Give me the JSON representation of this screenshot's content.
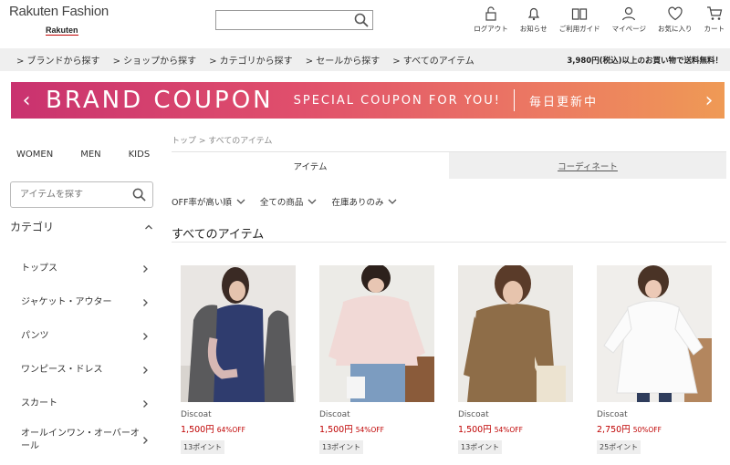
{
  "header": {
    "logo_main": "Rakuten Fashion",
    "logo_sub": "Rakuten",
    "search_placeholder": "",
    "nav": [
      {
        "icon": "lock-icon",
        "label": "ログアウト"
      },
      {
        "icon": "bell-icon",
        "label": "お知らせ"
      },
      {
        "icon": "book-icon",
        "label": "ご利用ガイド"
      },
      {
        "icon": "user-icon",
        "label": "マイページ"
      },
      {
        "icon": "heart-icon",
        "label": "お気に入り"
      },
      {
        "icon": "cart-icon",
        "label": "カート"
      }
    ]
  },
  "subnav": {
    "links": [
      "> ブランドから探す",
      "> ショップから探す",
      "> カテゴリから探す",
      "> セールから探す",
      "> すべてのアイテム"
    ],
    "shipping_note": "3,980円(税込)以上のお買い物で送料無料！"
  },
  "banner": {
    "title": "BRAND COUPON",
    "subtitle": "SPECIAL COUPON FOR YOU!",
    "daily": "毎日更新中",
    "prev": "‹",
    "next": "›"
  },
  "sidebar": {
    "genders": [
      "WOMEN",
      "MEN",
      "KIDS"
    ],
    "search_placeholder": "アイテムを探す",
    "category_heading": "カテゴリ",
    "categories": [
      "トップス",
      "ジャケット・アウター",
      "パンツ",
      "ワンピース・ドレス",
      "スカート",
      "オールインワン・オーバーオール"
    ]
  },
  "main": {
    "breadcrumb": "トップ > すべてのアイテム",
    "tabs": [
      "アイテム",
      "コーディネート"
    ],
    "filters": [
      "OFF率が高い順",
      "全ての商品",
      "在庫ありのみ"
    ],
    "section_title": "すべてのアイテム",
    "products": [
      {
        "brand": "Discoat",
        "price": "1,500円",
        "off": "64%OFF",
        "points": "13ポイント",
        "image": "model in navy knit with grey jacket"
      },
      {
        "brand": "Discoat",
        "price": "1,500円",
        "off": "54%OFF",
        "points": "13ポイント",
        "image": "model in pale pink top with jeans"
      },
      {
        "brand": "Discoat",
        "price": "1,500円",
        "off": "54%OFF",
        "points": "13ポイント",
        "image": "model in brown long sleeve top with tote"
      },
      {
        "brand": "Discoat",
        "price": "2,750円",
        "off": "50%OFF",
        "points": "25ポイント",
        "image": "model in white tunic blouse"
      }
    ]
  },
  "colors": {
    "accent_red": "#bf0000",
    "banner_start": "#c9326f",
    "banner_end": "#ef9a55",
    "subnav_bg": "#efefef"
  }
}
